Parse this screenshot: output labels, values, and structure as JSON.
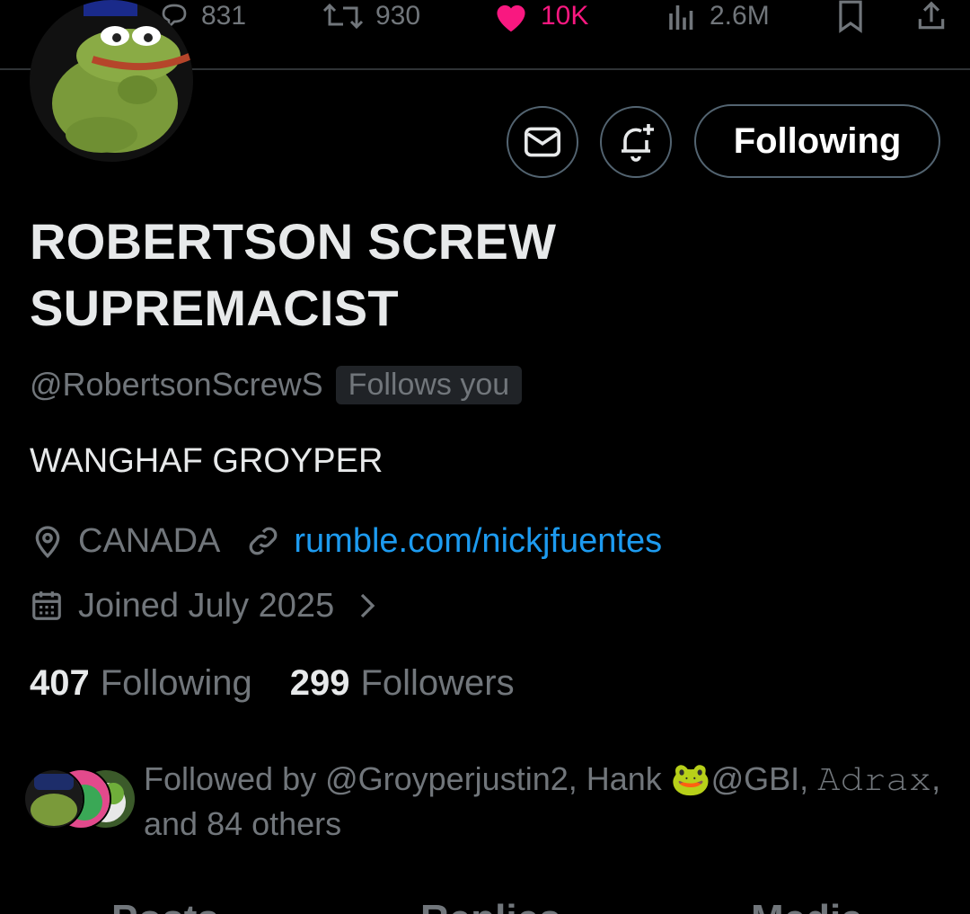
{
  "engagement": {
    "replies": "831",
    "reposts": "930",
    "likes": "10K",
    "views": "2.6M"
  },
  "profile": {
    "display_name_line1": "ROBERTSON SCREW",
    "display_name_line2": "SUPREMACIST",
    "handle": "@RobertsonScrewS",
    "follows_you_badge": "Follows you",
    "bio": "WANGHAF GROYPER",
    "location": "CANADA",
    "website": "rumble.com/nickjfuentes",
    "joined": "Joined July 2025"
  },
  "actions": {
    "follow_label": "Following"
  },
  "stats": {
    "following_count": "407",
    "following_label": "Following",
    "followers_count": "299",
    "followers_label": "Followers"
  },
  "followed_by": {
    "line1": "Followed by @Groyperjustin2, Hank 🐸@GBI, 𝙰𝚍𝚛𝚊𝚡,",
    "line2": "and 84 others"
  },
  "tabs": [
    "Posts",
    "Replies",
    "Media"
  ],
  "colors": {
    "background": "#000000",
    "text_primary": "#e7e9ea",
    "text_secondary": "#71767b",
    "link": "#1d9bf0",
    "like": "#f91880",
    "border": "#536471"
  }
}
